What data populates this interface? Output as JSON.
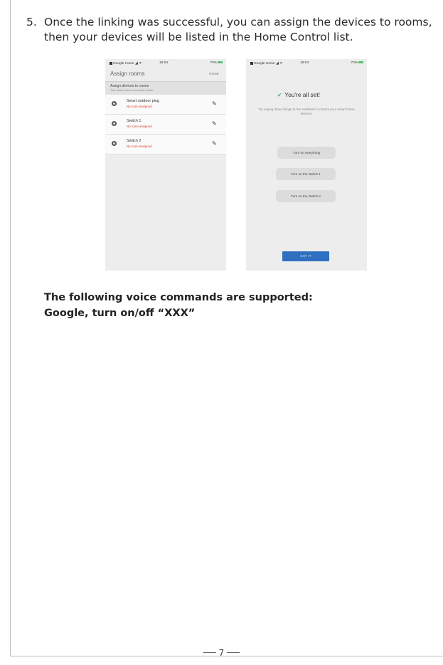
{
  "step": {
    "number": "5.",
    "text": "Once the linking was successful, you can assign the devices to rooms, then your devices will be listed in the Home Control list."
  },
  "phone_left": {
    "status": {
      "carrier": "Google Home",
      "time": "16:04",
      "battery": "70%"
    },
    "title": "Assign rooms",
    "done": "DONE",
    "header": {
      "title": "Assign devices to rooms",
      "subtitle": "This makes voice commands easier"
    },
    "devices": [
      {
        "name": "Smart outdoor plug",
        "room": "No room assigned"
      },
      {
        "name": "Switch 1",
        "room": "No room assigned"
      },
      {
        "name": "Switch 2",
        "room": "No room assigned"
      }
    ]
  },
  "phone_right": {
    "status": {
      "carrier": "Google Home",
      "time": "16:04",
      "battery": "70%"
    },
    "heading": "You're all set!",
    "subtext": "Try saying these things to the Assistant to control your smart home devices.",
    "suggestions": [
      "Turn on everything",
      "Turn on the Switch 1",
      "Turn on the Switch 2"
    ],
    "button": "GOT IT"
  },
  "commands": {
    "line1": "The following voice commands are supported:",
    "line2": "Google, turn on/off “XXX”"
  },
  "footer": {
    "page": "7"
  },
  "colors": {
    "accent_button": "#2f6fc0",
    "warning_text": "#d33c33",
    "check": "#4d9b5f"
  }
}
